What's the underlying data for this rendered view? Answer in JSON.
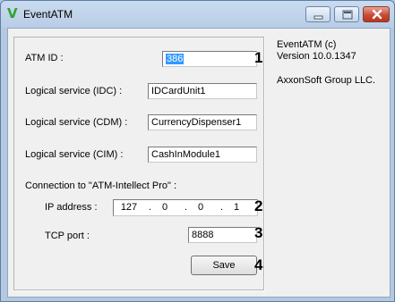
{
  "window": {
    "title": "EventATM",
    "icon": "v-app-icon"
  },
  "form": {
    "atm_id": {
      "label": "ATM ID :",
      "value": "386"
    },
    "idc": {
      "label": "Logical service (IDC) :",
      "value": "IDCardUnit1"
    },
    "cdm": {
      "label": "Logical service (CDM) :",
      "value": "CurrencyDispenser1"
    },
    "cim": {
      "label": "Logical service (CIM) :",
      "value": "CashInModule1"
    },
    "connection_label": "Connection to \"ATM-Intellect Pro\" :",
    "ip": {
      "label": "IP address :",
      "octets": [
        "127",
        "0",
        "0",
        "1"
      ],
      "separator": "."
    },
    "port": {
      "label": "TCP port :",
      "value": "8888"
    },
    "save_label": "Save"
  },
  "markers": [
    "1",
    "2",
    "3",
    "4"
  ],
  "about": {
    "product": "EventATM (c)",
    "version": "Version 10.0.1347",
    "company": "AxxonSoft Group LLC."
  }
}
